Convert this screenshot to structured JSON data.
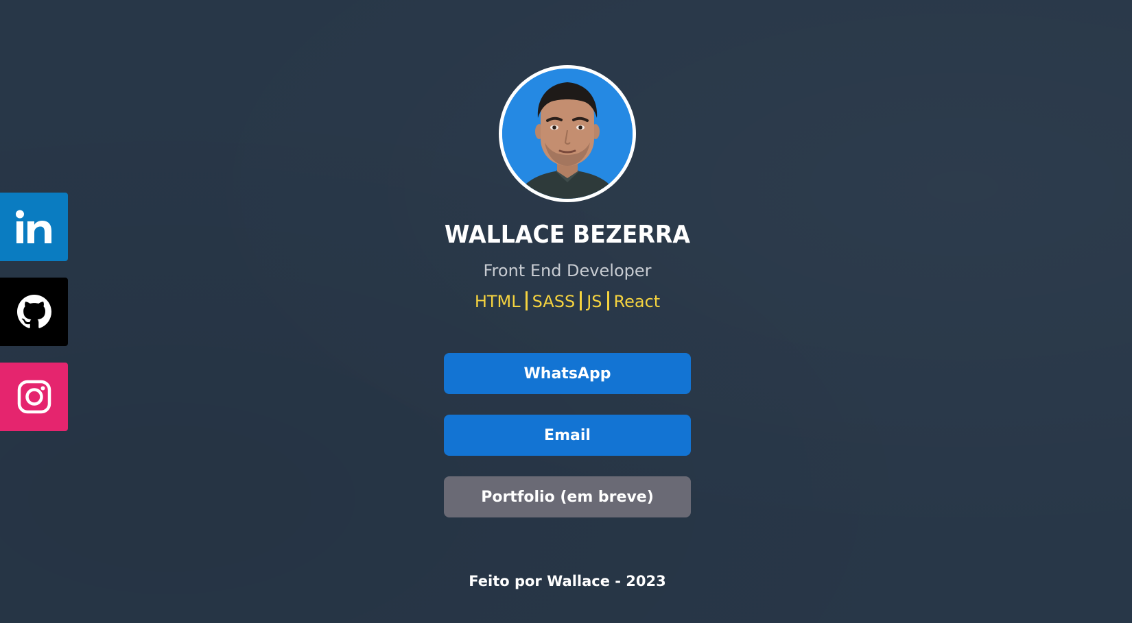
{
  "social": {
    "linkedin": {
      "icon": "linkedin-icon",
      "color": "#0A7CC1"
    },
    "github": {
      "icon": "github-icon",
      "color": "#000000"
    },
    "instagram": {
      "icon": "instagram-icon",
      "color": "#E5256E"
    }
  },
  "profile": {
    "name": "WALLACE BEZERRA",
    "role": "Front End Developer",
    "skills": [
      "HTML",
      "SASS",
      "JS",
      "React"
    ]
  },
  "buttons": {
    "whatsapp": "WhatsApp",
    "email": "Email",
    "portfolio": "Portfolio (em breve)"
  },
  "footer": {
    "text": "Feito por Wallace - 2023"
  },
  "colors": {
    "background": "#283748",
    "accent": "#1374D3",
    "skills": "#F5D33F",
    "disabled": "#6A6A75"
  }
}
